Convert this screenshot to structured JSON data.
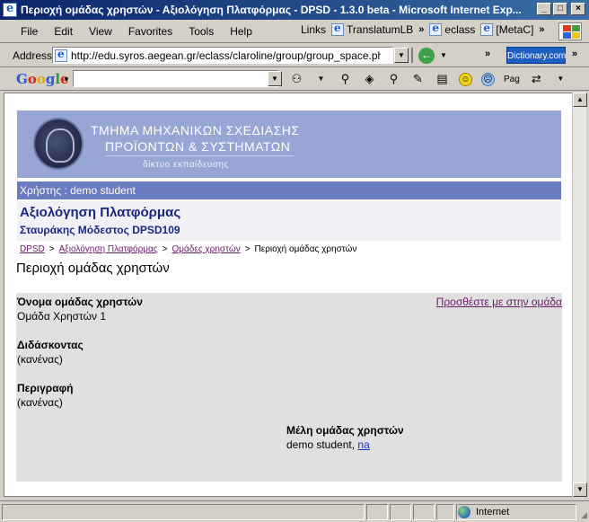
{
  "window": {
    "title": "Περιοχή ομάδας χρηστών - Αξιολόγηση Πλατφόρμας - DPSD - 1.3.0 beta - Microsoft Internet Exp...",
    "buttons": {
      "minimize": "_",
      "maximize": "□",
      "close": "×"
    }
  },
  "menubar": {
    "items": [
      "File",
      "Edit",
      "View",
      "Favorites",
      "Tools",
      "Help"
    ],
    "links_label": "Links",
    "links": [
      "TranslatumLB",
      "eclass",
      "[MetaC]"
    ]
  },
  "addressbar": {
    "label": "Address",
    "url": "http://edu.syros.aegean.gr/eclass/claroline/group/group_space.php?selfR",
    "dictionary_label": "Dictionary.com"
  },
  "googlebar": {
    "logo": "Google",
    "pag_label": "Pag"
  },
  "page": {
    "banner": {
      "line1": "ΤΜΗΜΑ ΜΗΧΑΝΙΚΩΝ ΣΧΕΔΙΑΣΗΣ",
      "line2": "ΠΡΟΪΟΝΤΩΝ & ΣΥΣΤΗΜΑΤΩΝ",
      "line3": "δίκτυο εκπαίδευσης"
    },
    "user_line": "Χρήστης : demo student",
    "course_title": "Αξιολόγηση Πλατφόρμας",
    "course_subtitle": "Σταυράκης Μόδεστος DPSD109",
    "breadcrumb": {
      "items": [
        "DPSD",
        "Αξιολόγηση Πλατφόρμας",
        "Ομάδες χρηστών"
      ],
      "current": "Περιοχή ομάδας χρηστών",
      "separator": ">"
    },
    "title": "Περιοχή ομάδας χρηστών",
    "group": {
      "name_label": "Όνομα ομάδας χρηστών",
      "name_value": "Ομάδα Χρηστών 1",
      "join_link": "Προσθέστε με στην ομάδα",
      "tutor_label": "Διδάσκοντας",
      "tutor_value": "(κανένας)",
      "description_label": "Περιγραφή",
      "description_value": "(κανένας)",
      "members_label": "Μέλη ομάδας χρηστών",
      "members_value": "demo student, ",
      "members_link": "na"
    }
  },
  "statusbar": {
    "zone": "Internet"
  }
}
